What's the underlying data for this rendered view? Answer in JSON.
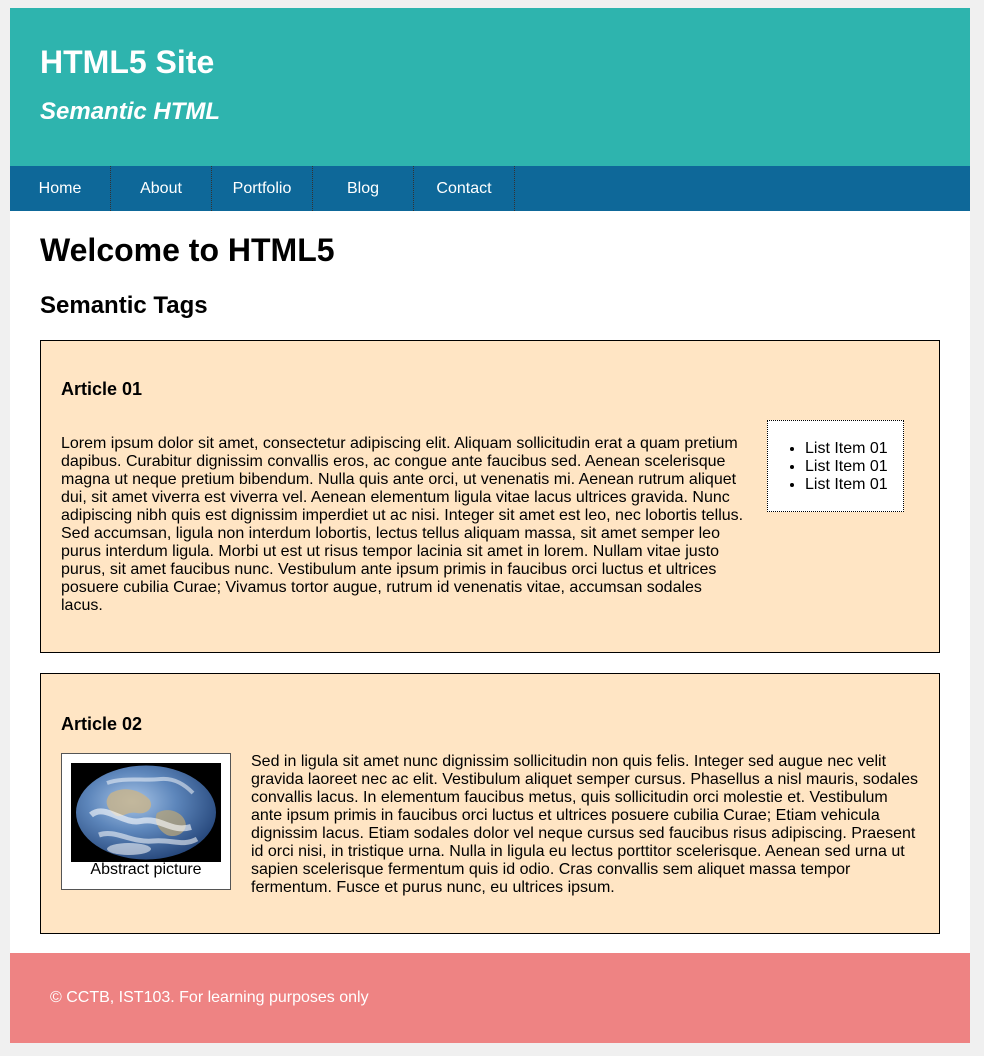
{
  "header": {
    "title": "HTML5 Site",
    "subtitle": "Semantic HTML"
  },
  "nav": {
    "items": [
      "Home",
      "About",
      "Portfolio",
      "Blog",
      "Contact"
    ]
  },
  "main": {
    "title": "Welcome to HTML5",
    "section_title": "Semantic Tags",
    "article1": {
      "title": "Article 01",
      "body": "Lorem ipsum dolor sit amet, consectetur adipiscing elit. Aliquam sollicitudin erat a quam pretium dapibus. Curabitur dignissim convallis eros, ac congue ante faucibus sed. Aenean scelerisque magna ut neque pretium bibendum. Nulla quis ante orci, ut venenatis mi. Aenean rutrum aliquet dui, sit amet viverra est viverra vel. Aenean elementum ligula vitae lacus ultrices gravida. Nunc adipiscing nibh quis est dignissim imperdiet ut ac nisi. Integer sit amet est leo, nec lobortis tellus. Sed accumsan, ligula non interdum lobortis, lectus tellus aliquam massa, sit amet semper leo purus interdum ligula. Morbi ut est ut risus tempor lacinia sit amet in lorem. Nullam vitae justo purus, sit amet faucibus nunc. Vestibulum ante ipsum primis in faucibus orci luctus et ultrices posuere cubilia Curae; Vivamus tortor augue, rutrum id venenatis vitae, accumsan sodales lacus.",
      "list": [
        "List Item 01",
        "List Item 01",
        "List Item 01"
      ]
    },
    "article2": {
      "title": "Article 02",
      "caption": "Abstract picture",
      "body": "Sed in ligula sit amet nunc dignissim sollicitudin non quis felis. Integer sed augue nec velit gravida laoreet nec ac elit. Vestibulum aliquet semper cursus. Phasellus a nisl mauris, sodales convallis lacus. In elementum faucibus metus, quis sollicitudin orci molestie et. Vestibulum ante ipsum primis in faucibus orci luctus et ultrices posuere cubilia Curae; Etiam vehicula dignissim lacus. Etiam sodales dolor vel neque cursus sed faucibus risus adipiscing. Praesent id orci nisi, in tristique urna. Nulla in ligula eu lectus porttitor scelerisque. Aenean sed urna ut sapien scelerisque fermentum quis id odio. Cras convallis sem aliquet massa tempor fermentum. Fusce et purus nunc, eu ultrices ipsum."
    }
  },
  "footer": {
    "text": "© CCTB, IST103. For learning purposes only"
  },
  "colors": {
    "header_bg": "#2eb4ae",
    "nav_bg": "#0e6899",
    "article_bg": "#ffe5c4",
    "footer_bg": "#ee8383"
  }
}
